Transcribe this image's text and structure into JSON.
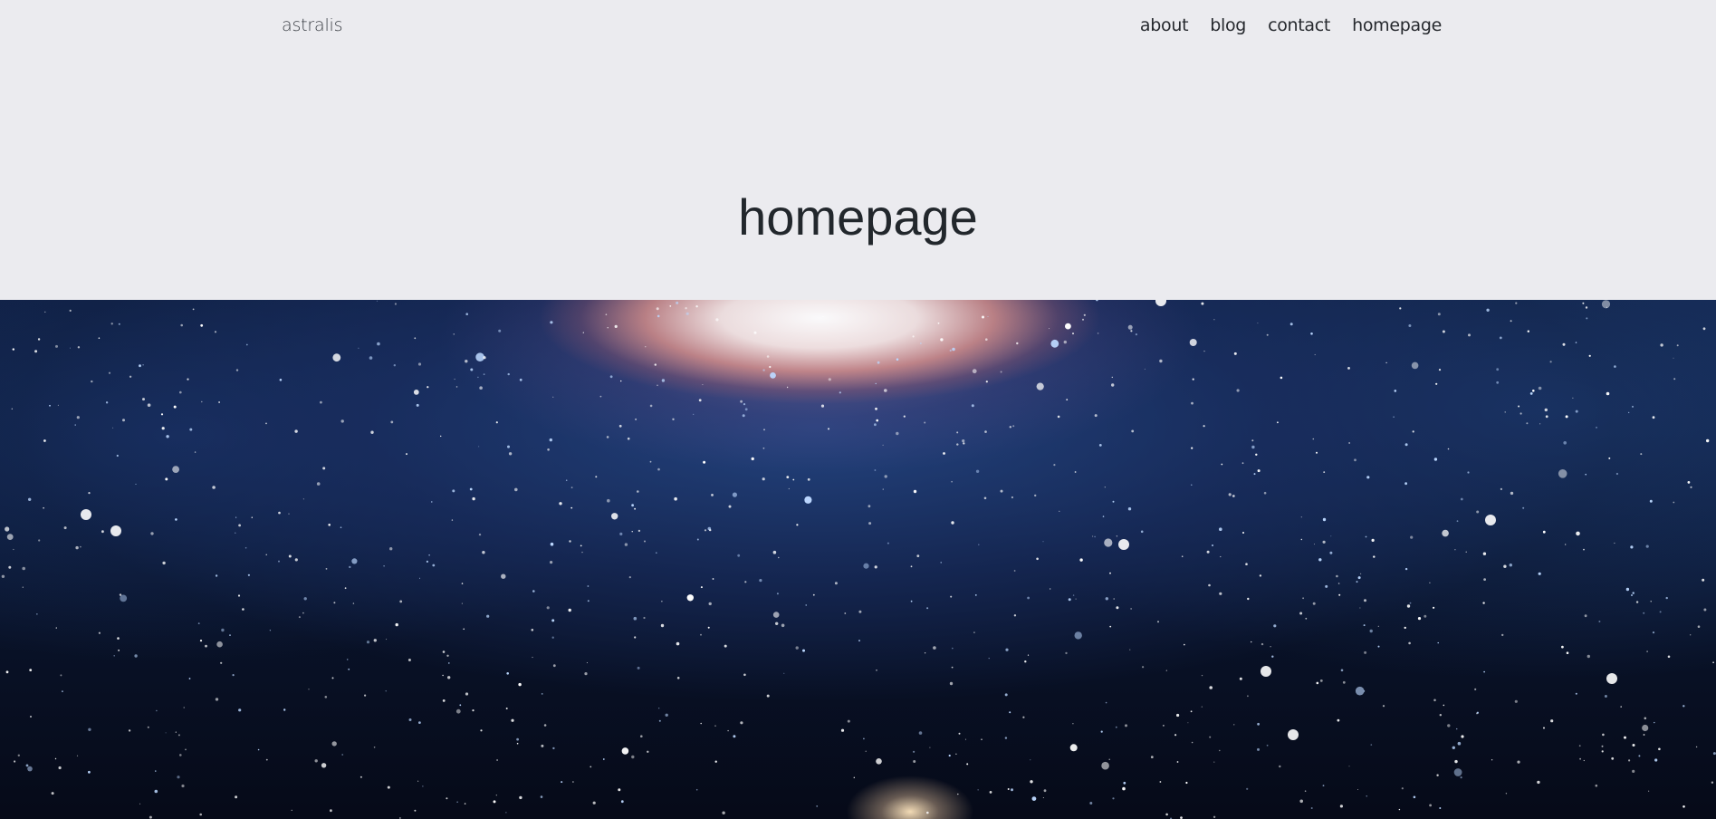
{
  "site": {
    "name": "astralis"
  },
  "nav": {
    "items": [
      "about",
      "blog",
      "contact",
      "homepage"
    ]
  },
  "page": {
    "title": "homepage"
  },
  "hero": {
    "image": "galaxy-starfield-image"
  }
}
